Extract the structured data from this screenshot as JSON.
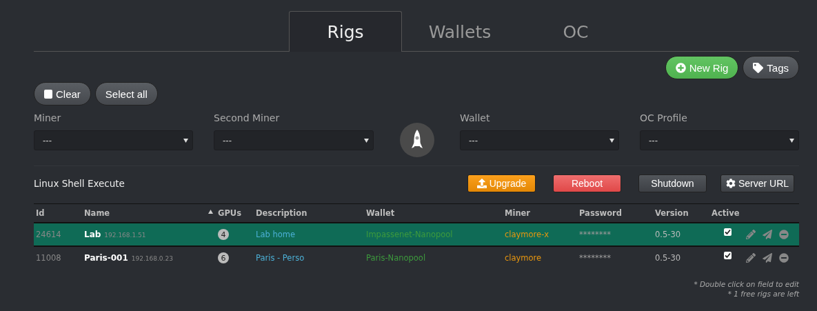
{
  "tabs": [
    {
      "label": "Rigs",
      "selected": true
    },
    {
      "label": "Wallets",
      "selected": false
    },
    {
      "label": "OC",
      "selected": false
    }
  ],
  "top_actions": [
    {
      "label": "New Rig",
      "kind": "green"
    },
    {
      "label": "Tags",
      "kind": "grey"
    }
  ],
  "selection_buttons": [
    {
      "label": "Clear"
    },
    {
      "label": "Select all"
    }
  ],
  "selectors": [
    {
      "label": "Miner",
      "value": "---"
    },
    {
      "label": "Second Miner",
      "value": "---"
    },
    {
      "label": "Wallet",
      "value": "---"
    },
    {
      "label": "OC Profile",
      "value": "---"
    }
  ],
  "shell": {
    "title": "Linux Shell Execute",
    "buttons": [
      {
        "label": "Upgrade",
        "kind": "orange"
      },
      {
        "label": "Reboot",
        "kind": "red"
      },
      {
        "label": "Shutdown",
        "kind": "dark"
      },
      {
        "label": "Server URL",
        "kind": "dark"
      }
    ]
  },
  "table": {
    "columns": [
      "Id",
      "Name",
      "GPUs",
      "Description",
      "Wallet",
      "Miner",
      "Password",
      "Version",
      "Active"
    ],
    "rows": [
      {
        "id": "24614",
        "name": "Lab",
        "ip": "192.168.1.51",
        "gpus": "4",
        "description": "Lab home",
        "wallet": "Impassenet-Nanopool",
        "miner": "claymore-x",
        "password": "********",
        "version": "0.5-30",
        "active": true,
        "selected": true
      },
      {
        "id": "11008",
        "name": "Paris-001",
        "ip": "192.168.0.23",
        "gpus": "6",
        "description": "Paris - Perso",
        "wallet": "Paris-Nanopool",
        "miner": "claymore",
        "password": "********",
        "version": "0.5-30",
        "active": true,
        "selected": false
      }
    ]
  },
  "notes": [
    "* Double click on field to edit",
    "* 1 free rigs are left"
  ]
}
